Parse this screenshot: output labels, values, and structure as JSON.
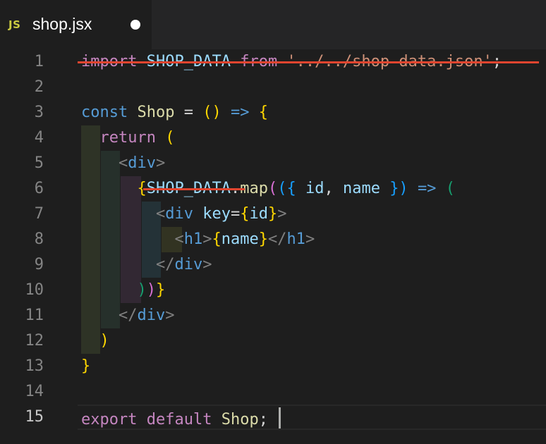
{
  "tab": {
    "icon": "JS",
    "file_name": "shop.jsx",
    "dirty_indicator": "unsaved-dot"
  },
  "line_numbers": [
    "1",
    "2",
    "3",
    "4",
    "5",
    "6",
    "7",
    "8",
    "9",
    "10",
    "11",
    "12",
    "13",
    "14",
    "15"
  ],
  "code": {
    "l1": {
      "kw": "import",
      "name": "SHOP_DATA",
      "from": "from",
      "path": "'../../shop-data.json'",
      "semi": ";"
    },
    "l3": {
      "kw": "const",
      "name": "Shop",
      "eq": "=",
      "paren": "()",
      "arrow": "=>",
      "brace": "{"
    },
    "l4": {
      "kw": "return",
      "paren": "("
    },
    "l5": {
      "open": "<",
      "tag": "div",
      "close": ">"
    },
    "l6": {
      "brace": "{",
      "name": "SHOP_DATA",
      "dot": ".",
      "fn": "map",
      "p1": "(",
      "p2": "({",
      "id": "id",
      "comma": ",",
      "pname": "name",
      "p3": "})",
      "arrow": "=>",
      "p4": "("
    },
    "l7": {
      "open": "<",
      "tag": "div",
      "attr": "key",
      "eq": "=",
      "b1": "{",
      "val": "id",
      "b2": "}",
      "close": ">"
    },
    "l8": {
      "open": "<",
      "tag": "h1",
      "close": ">",
      "b1": "{",
      "val": "name",
      "b2": "}",
      "open2": "</",
      "tag2": "h1",
      "close2": ">"
    },
    "l9": {
      "open": "</",
      "tag": "div",
      "close": ">"
    },
    "l10": {
      "p1": ")",
      "p2": ")",
      "b": "}"
    },
    "l11": {
      "open": "</",
      "tag": "div",
      "close": ">"
    },
    "l12": {
      "paren": ")"
    },
    "l13": {
      "brace": "}"
    },
    "l15": {
      "kw1": "export",
      "kw2": "default",
      "name": "Shop",
      "semi": ";"
    }
  },
  "colors": {
    "background": "#1e1e1e",
    "strikethrough": "#e0452f"
  }
}
